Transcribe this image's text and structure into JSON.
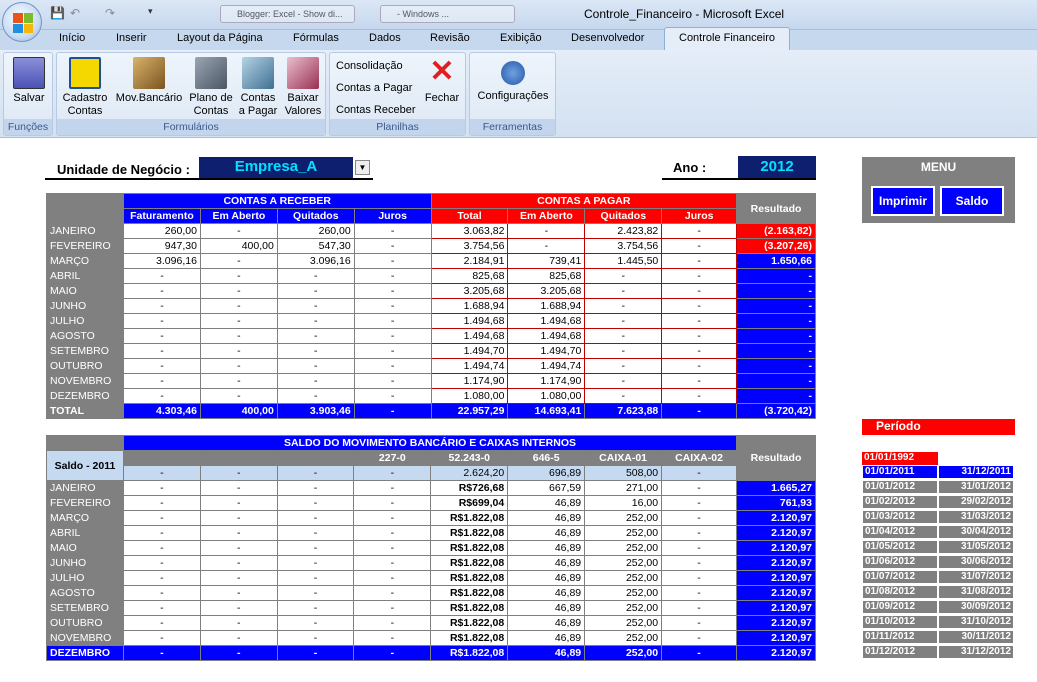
{
  "window": {
    "title": "Controle_Financeiro  -  Microsoft Excel",
    "bg_tabs": [
      "Blogger: Excel - Show di...",
      " - Windows ..."
    ]
  },
  "tabs": [
    "Início",
    "Inserir",
    "Layout da Página",
    "Fórmulas",
    "Dados",
    "Revisão",
    "Exibição",
    "Desenvolvedor"
  ],
  "active_tab": "Controle Financeiro",
  "ribbon": {
    "funcoes": {
      "label": "Funções",
      "salvar": "Salvar"
    },
    "formularios": {
      "label": "Formulários",
      "cadastro1": "Cadastro",
      "cadastro2": "Contas",
      "mov": "Mov.Bancário",
      "plano1": "Plano de",
      "plano2": "Contas",
      "contas1": "Contas",
      "contas2": "a Pagar",
      "baixar1": "Baixar",
      "baixar2": "Valores"
    },
    "planilhas": {
      "label": "Planilhas",
      "consolidacao": "Consolidação",
      "contas_pagar": "Contas a Pagar",
      "contas_receber": "Contas Receber",
      "fechar": "Fechar"
    },
    "ferramentas": {
      "label": "Ferramentas",
      "config": "Configurações"
    }
  },
  "header": {
    "unidade_label": "Unidade de Negócio :",
    "unidade_value": "Empresa_A",
    "ano_label": "Ano :",
    "ano_value": "2012"
  },
  "menu": {
    "title": "MENU",
    "imprimir": "Imprimir",
    "saldo": "Saldo"
  },
  "table1": {
    "receber_title": "CONTAS A RECEBER",
    "pagar_title": "CONTAS A PAGAR",
    "resultado": "Resultado",
    "cols": [
      "Faturamento",
      "Em Aberto",
      "Quitados",
      "Juros",
      "Total",
      "Em Aberto",
      "Quitados",
      "Juros"
    ],
    "rows": [
      [
        "JANEIRO",
        "260,00",
        "-",
        "260,00",
        "-",
        "3.063,82",
        "-",
        "2.423,82",
        "-",
        "(2.163,82)"
      ],
      [
        "FEVEREIRO",
        "947,30",
        "400,00",
        "547,30",
        "-",
        "3.754,56",
        "-",
        "3.754,56",
        "-",
        "(3.207,26)"
      ],
      [
        "MARÇO",
        "3.096,16",
        "-",
        "3.096,16",
        "-",
        "2.184,91",
        "739,41",
        "1.445,50",
        "-",
        "1.650,66"
      ],
      [
        "ABRIL",
        "-",
        "-",
        "-",
        "-",
        "825,68",
        "825,68",
        "-",
        "-",
        "-"
      ],
      [
        "MAIO",
        "-",
        "-",
        "-",
        "-",
        "3.205,68",
        "3.205,68",
        "-",
        "-",
        "-"
      ],
      [
        "JUNHO",
        "-",
        "-",
        "-",
        "-",
        "1.688,94",
        "1.688,94",
        "-",
        "-",
        "-"
      ],
      [
        "JULHO",
        "-",
        "-",
        "-",
        "-",
        "1.494,68",
        "1.494,68",
        "-",
        "-",
        "-"
      ],
      [
        "AGOSTO",
        "-",
        "-",
        "-",
        "-",
        "1.494,68",
        "1.494,68",
        "-",
        "-",
        "-"
      ],
      [
        "SETEMBRO",
        "-",
        "-",
        "-",
        "-",
        "1.494,70",
        "1.494,70",
        "-",
        "-",
        "-"
      ],
      [
        "OUTUBRO",
        "-",
        "-",
        "-",
        "-",
        "1.494,74",
        "1.494,74",
        "-",
        "-",
        "-"
      ],
      [
        "NOVEMBRO",
        "-",
        "-",
        "-",
        "-",
        "1.174,90",
        "1.174,90",
        "-",
        "-",
        "-"
      ],
      [
        "DEZEMBRO",
        "-",
        "-",
        "-",
        "-",
        "1.080,00",
        "1.080,00",
        "-",
        "-",
        "-"
      ]
    ],
    "total": [
      "TOTAL",
      "4.303,46",
      "400,00",
      "3.903,46",
      "-",
      "22.957,29",
      "14.693,41",
      "7.623,88",
      "-",
      "(3.720,42)"
    ]
  },
  "table2": {
    "title": "SALDO DO MOVIMENTO BANCÁRIO E CAIXAS INTERNOS",
    "resultado": "Resultado",
    "saldo_label": "Saldo - 2011",
    "cols": [
      "",
      "",
      "",
      "227-0",
      "52.243-0",
      "646-5",
      "CAIXA-01",
      "CAIXA-02"
    ],
    "saldo": [
      "-",
      "-",
      "-",
      "-",
      "2.624,20",
      "696,89",
      "508,00",
      "-"
    ],
    "rows": [
      [
        "JANEIRO",
        "-",
        "-",
        "-",
        "-",
        "R$726,68",
        "667,59",
        "271,00",
        "-",
        "1.665,27"
      ],
      [
        "FEVEREIRO",
        "-",
        "-",
        "-",
        "-",
        "R$699,04",
        "46,89",
        "16,00",
        "-",
        "761,93"
      ],
      [
        "MARÇO",
        "-",
        "-",
        "-",
        "-",
        "R$1.822,08",
        "46,89",
        "252,00",
        "-",
        "2.120,97"
      ],
      [
        "ABRIL",
        "-",
        "-",
        "-",
        "-",
        "R$1.822,08",
        "46,89",
        "252,00",
        "-",
        "2.120,97"
      ],
      [
        "MAIO",
        "-",
        "-",
        "-",
        "-",
        "R$1.822,08",
        "46,89",
        "252,00",
        "-",
        "2.120,97"
      ],
      [
        "JUNHO",
        "-",
        "-",
        "-",
        "-",
        "R$1.822,08",
        "46,89",
        "252,00",
        "-",
        "2.120,97"
      ],
      [
        "JULHO",
        "-",
        "-",
        "-",
        "-",
        "R$1.822,08",
        "46,89",
        "252,00",
        "-",
        "2.120,97"
      ],
      [
        "AGOSTO",
        "-",
        "-",
        "-",
        "-",
        "R$1.822,08",
        "46,89",
        "252,00",
        "-",
        "2.120,97"
      ],
      [
        "SETEMBRO",
        "-",
        "-",
        "-",
        "-",
        "R$1.822,08",
        "46,89",
        "252,00",
        "-",
        "2.120,97"
      ],
      [
        "OUTUBRO",
        "-",
        "-",
        "-",
        "-",
        "R$1.822,08",
        "46,89",
        "252,00",
        "-",
        "2.120,97"
      ],
      [
        "NOVEMBRO",
        "-",
        "-",
        "-",
        "-",
        "R$1.822,08",
        "46,89",
        "252,00",
        "-",
        "2.120,97"
      ]
    ],
    "last": [
      "DEZEMBRO",
      "-",
      "-",
      "-",
      "-",
      "R$1.822,08",
      "46,89",
      "252,00",
      "-",
      "2.120,97"
    ]
  },
  "periodo": {
    "label": "Período",
    "first": "01/01/1992",
    "rows": [
      [
        "01/01/2011",
        "31/12/2011"
      ],
      [
        "01/01/2012",
        "31/01/2012"
      ],
      [
        "01/02/2012",
        "29/02/2012"
      ],
      [
        "01/03/2012",
        "31/03/2012"
      ],
      [
        "01/04/2012",
        "30/04/2012"
      ],
      [
        "01/05/2012",
        "31/05/2012"
      ],
      [
        "01/06/2012",
        "30/06/2012"
      ],
      [
        "01/07/2012",
        "31/07/2012"
      ],
      [
        "01/08/2012",
        "31/08/2012"
      ],
      [
        "01/09/2012",
        "30/09/2012"
      ],
      [
        "01/10/2012",
        "31/10/2012"
      ],
      [
        "01/11/2012",
        "30/11/2012"
      ],
      [
        "01/12/2012",
        "31/12/2012"
      ]
    ]
  }
}
